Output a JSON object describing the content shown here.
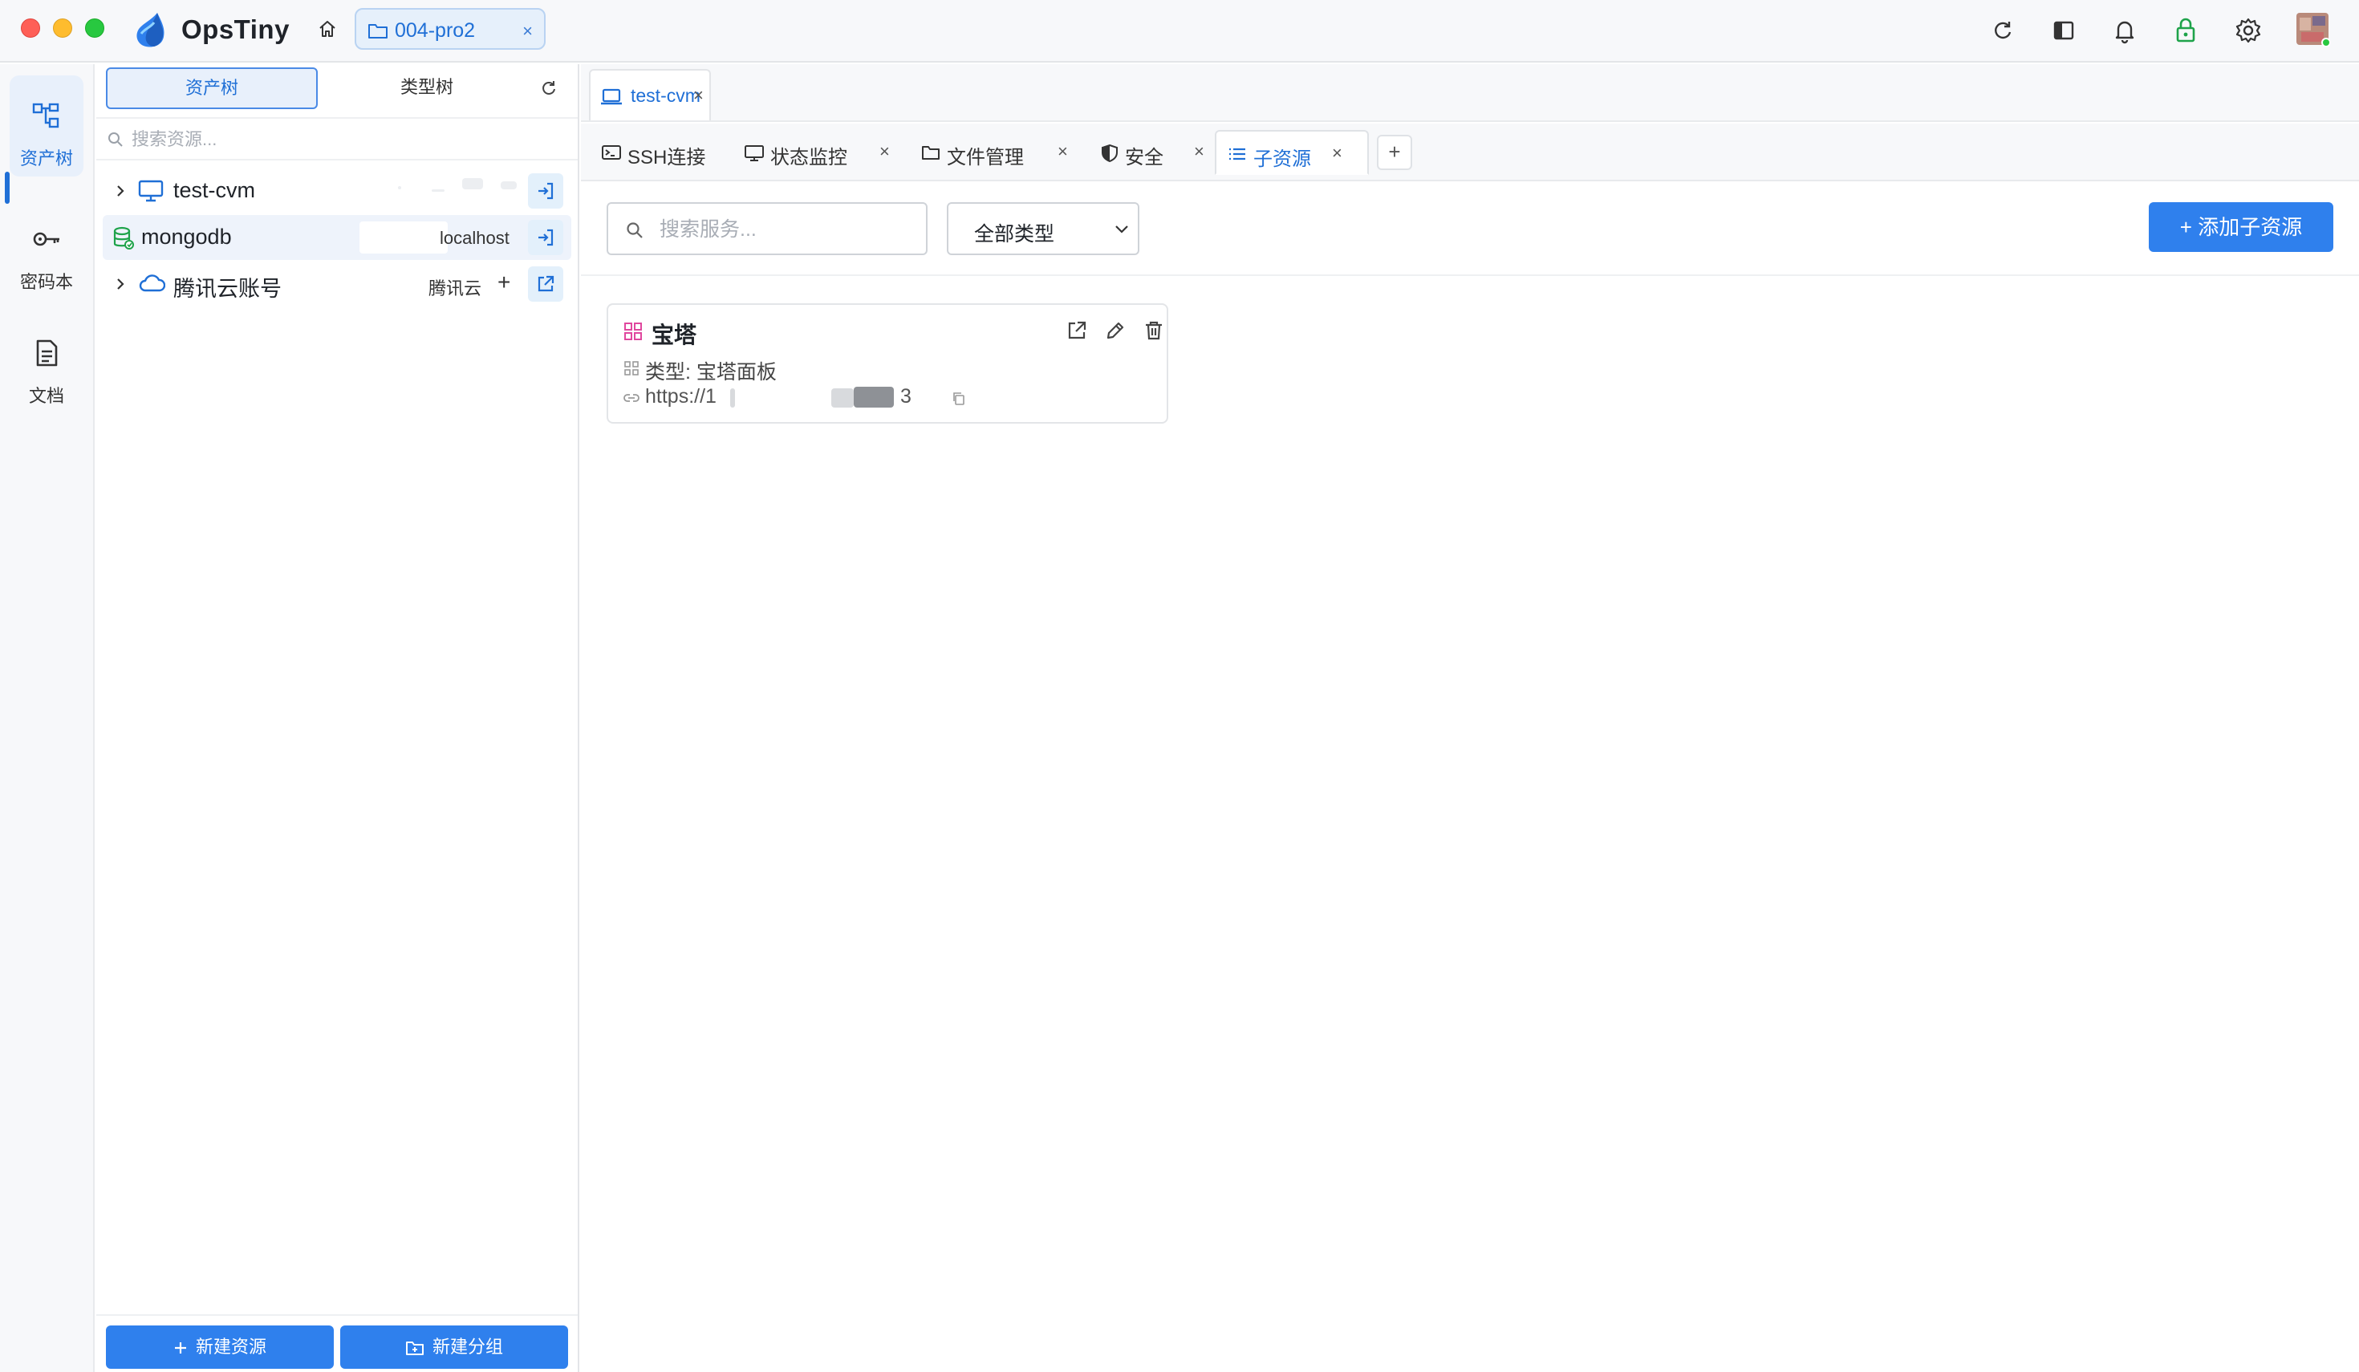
{
  "app": {
    "name": "OpsTiny"
  },
  "workspace_tab": {
    "label": "004-pro2",
    "close": "×"
  },
  "rail": {
    "items": [
      {
        "label": "资产树",
        "icon": "asset-tree-icon",
        "active": true
      },
      {
        "label": "密码本",
        "icon": "key-icon",
        "active": false
      },
      {
        "label": "文档",
        "icon": "document-icon",
        "active": false
      }
    ]
  },
  "tree": {
    "tabs": {
      "asset_tree": "资产树",
      "type_tree": "类型树"
    },
    "search_placeholder": "搜索资源...",
    "rows": [
      {
        "name": "test-cvm",
        "icon": "monitor-icon",
        "meta": ""
      },
      {
        "name": "mongodb",
        "icon": "database-icon",
        "meta": "localhost"
      },
      {
        "name": "腾讯云账号",
        "icon": "cloud-icon",
        "meta": "腾讯云",
        "plus": "+"
      }
    ],
    "footer": {
      "new_resource": "新建资源",
      "new_group": "新建分组"
    }
  },
  "connection_tab": {
    "label": "test-cvm",
    "close": "×"
  },
  "tool_tabs": [
    {
      "label": "SSH连接",
      "icon": "terminal-icon",
      "close": ""
    },
    {
      "label": "状态监控",
      "icon": "monitor-icon",
      "close": "×"
    },
    {
      "label": "文件管理",
      "icon": "folder-icon",
      "close": "×"
    },
    {
      "label": "安全",
      "icon": "shield-icon",
      "close": "×"
    },
    {
      "label": "子资源",
      "icon": "list-icon",
      "close": "×",
      "active": true
    }
  ],
  "add_tab": "+",
  "filter": {
    "search_placeholder": "搜索服务...",
    "type_select": "全部类型",
    "add_button": "+ 添加子资源"
  },
  "service_card": {
    "name": "宝塔",
    "type_line": "类型:  宝塔面板",
    "url_start": "https://1",
    "url_end": "3"
  },
  "colors": {
    "accent": "#2f80ed",
    "active_text": "#1f6fd6",
    "card_icon": "#e0479e"
  }
}
